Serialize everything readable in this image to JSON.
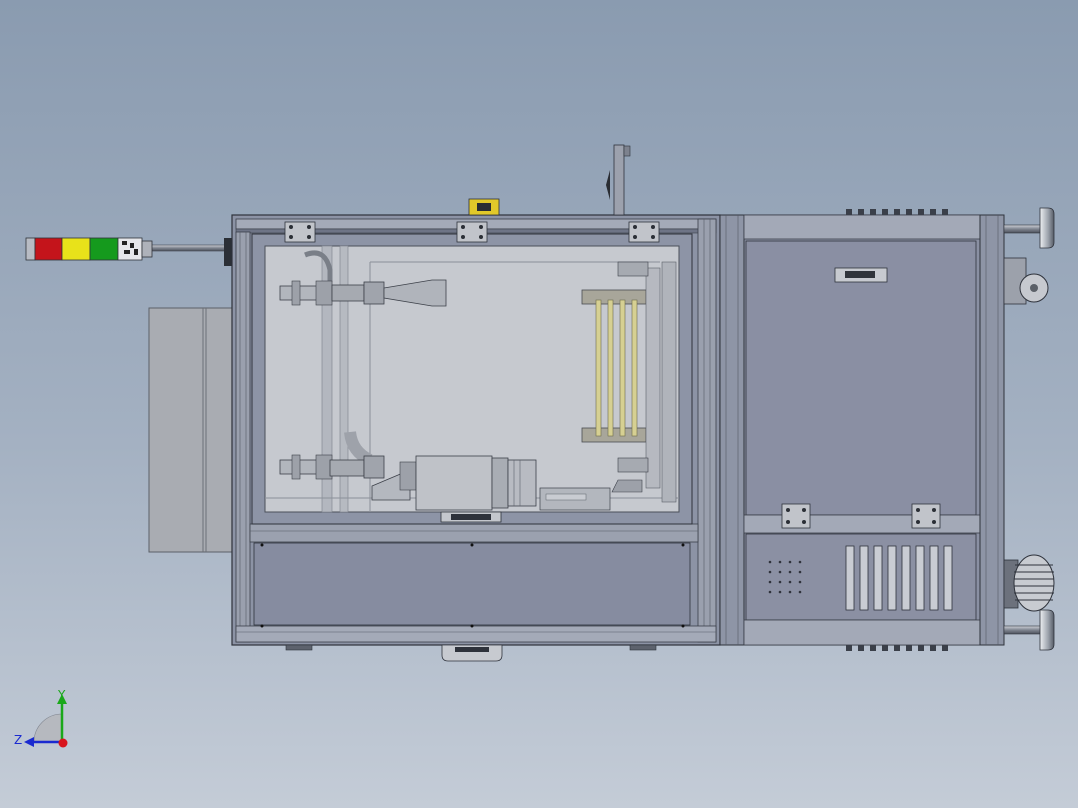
{
  "triad": {
    "y_label": "Y",
    "z_label": "Z"
  },
  "colors": {
    "frame": "#8e95a6",
    "frame_dark": "#3a3f4a",
    "panel": "#8a8fa3",
    "glass": "#c9ccd2",
    "light_red": "#c4141b",
    "light_yellow": "#e8e21a",
    "light_green": "#159a1d",
    "y_axis": "#1aa81a",
    "z_axis": "#1a2ad0",
    "origin": "#d8141c"
  }
}
